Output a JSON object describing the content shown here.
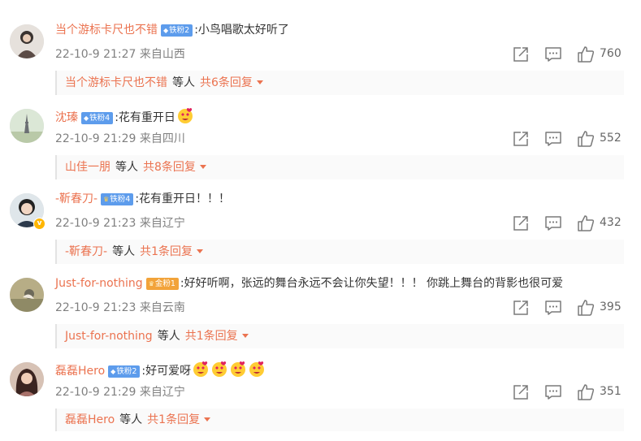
{
  "comments": [
    {
      "username": "当个游标卡尺也不错",
      "fan_badge": "铁粉2",
      "badge_color": "#5d9cec",
      "text": ":小鸟唱歌太好听了",
      "emoji_count": 0,
      "time": "22-10-9 21:27",
      "location": "来自山西",
      "likes": "760",
      "verified": false,
      "reply_user": "当个游标卡尺也不错",
      "reply_mid": "等人",
      "reply_more": "共6条回复"
    },
    {
      "username": "沈瑧",
      "fan_badge": "铁粉4",
      "badge_color": "#5d9cec",
      "text": ":花有重开日",
      "emoji_count": 1,
      "time": "22-10-9 21:29",
      "location": "来自四川",
      "likes": "552",
      "verified": false,
      "reply_user": "山佳一朋",
      "reply_mid": "等人",
      "reply_more": "共8条回复"
    },
    {
      "username": "-靳春刀-",
      "fan_badge": "铁粉4",
      "badge_color": "#5d9cec",
      "text": ":花有重开日！！！",
      "emoji_count": 0,
      "time": "22-10-9 21:23",
      "location": "来自辽宁",
      "likes": "432",
      "verified": true,
      "reply_user": "-靳春刀-",
      "reply_mid": "等人",
      "reply_more": "共1条回复"
    },
    {
      "username": "Just-for-nothing",
      "fan_badge": "金粉1",
      "badge_color": "#f2a33a",
      "text": ":好好听啊，张远的舞台永远不会让你失望！！！ 你跳上舞台的背影也很可爱",
      "emoji_count": 0,
      "time": "22-10-9 21:23",
      "location": "来自云南",
      "likes": "395",
      "verified": false,
      "reply_user": "Just-for-nothing",
      "reply_mid": "等人",
      "reply_more": "共1条回复"
    },
    {
      "username": "磊磊Hero",
      "fan_badge": "铁粉2",
      "badge_color": "#5d9cec",
      "text": ":好可爱呀",
      "emoji_count": 4,
      "time": "22-10-9 21:29",
      "location": "来自辽宁",
      "likes": "351",
      "verified": false,
      "reply_user": "磊磊Hero",
      "reply_mid": "等人",
      "reply_more": "共1条回复"
    }
  ],
  "colors": {
    "username": "#eb7350",
    "meta": "#808080",
    "text": "#333333"
  },
  "icons": {
    "share": "share-icon",
    "comment": "comment-icon",
    "like": "like-icon",
    "expand": "chevron-down-icon"
  }
}
